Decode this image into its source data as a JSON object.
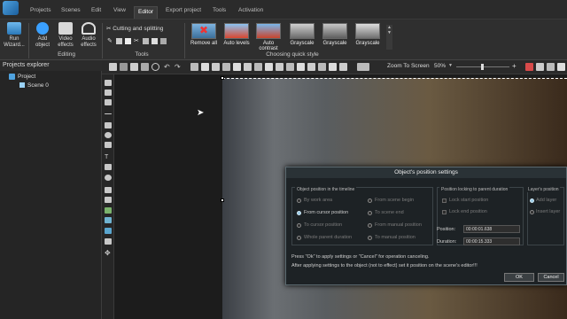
{
  "menu": {
    "tabs": [
      "Projects",
      "Scenes",
      "Edit",
      "View",
      "Editor",
      "Export project",
      "Tools",
      "Activation"
    ],
    "active": "Editor"
  },
  "ribbon": {
    "run_wizard": "Run\nWizard...",
    "add_object": "Add\nobject",
    "video_effects": "Video\neffects",
    "audio_effects": "Audio\neffects",
    "editing_label": "Editing",
    "cutting": "Cutting and splitting",
    "tools_label": "Tools",
    "quick_styles": [
      "Remove all",
      "Auto levels",
      "Auto contrast",
      "Grayscale",
      "Grayscale",
      "Grayscale"
    ],
    "quick_style_label": "Choosing quick style"
  },
  "toolbar": {
    "zoom_label": "Zoom To Screen",
    "zoom_value": "50%"
  },
  "explorer": {
    "title": "Projects explorer",
    "project": "Project",
    "scene": "Scene 0"
  },
  "dialog": {
    "title": "Object's position settings",
    "group1": "Object position in the timeline",
    "opt_by_work_area": "By work area",
    "opt_from_cursor": "From cursor position",
    "opt_to_cursor": "To cursor position",
    "opt_whole_parent": "Whole parent duration",
    "opt_from_scene_begin": "From scene begin",
    "opt_to_scene_end": "To scene end",
    "opt_from_manual": "From manual position",
    "opt_to_manual": "To manual position",
    "group2": "Position locking to parent duration",
    "lock_start": "Lock start position",
    "lock_end": "Lock end position",
    "position_label": "Position:",
    "position_value": "00:00:01.638",
    "duration_label": "Duration:",
    "duration_value": "00:00:15.333",
    "group3": "Layer's position",
    "add_layer": "Add layer",
    "insert_layer": "Insert layer",
    "hint1": "Press \"Ok\" to apply settings or \"Cancel\" for operation canceling.",
    "hint2": "After applying settings to the object (not to effect) set it position on the scene's editor!!!",
    "ok": "OK",
    "cancel": "Cancel"
  }
}
